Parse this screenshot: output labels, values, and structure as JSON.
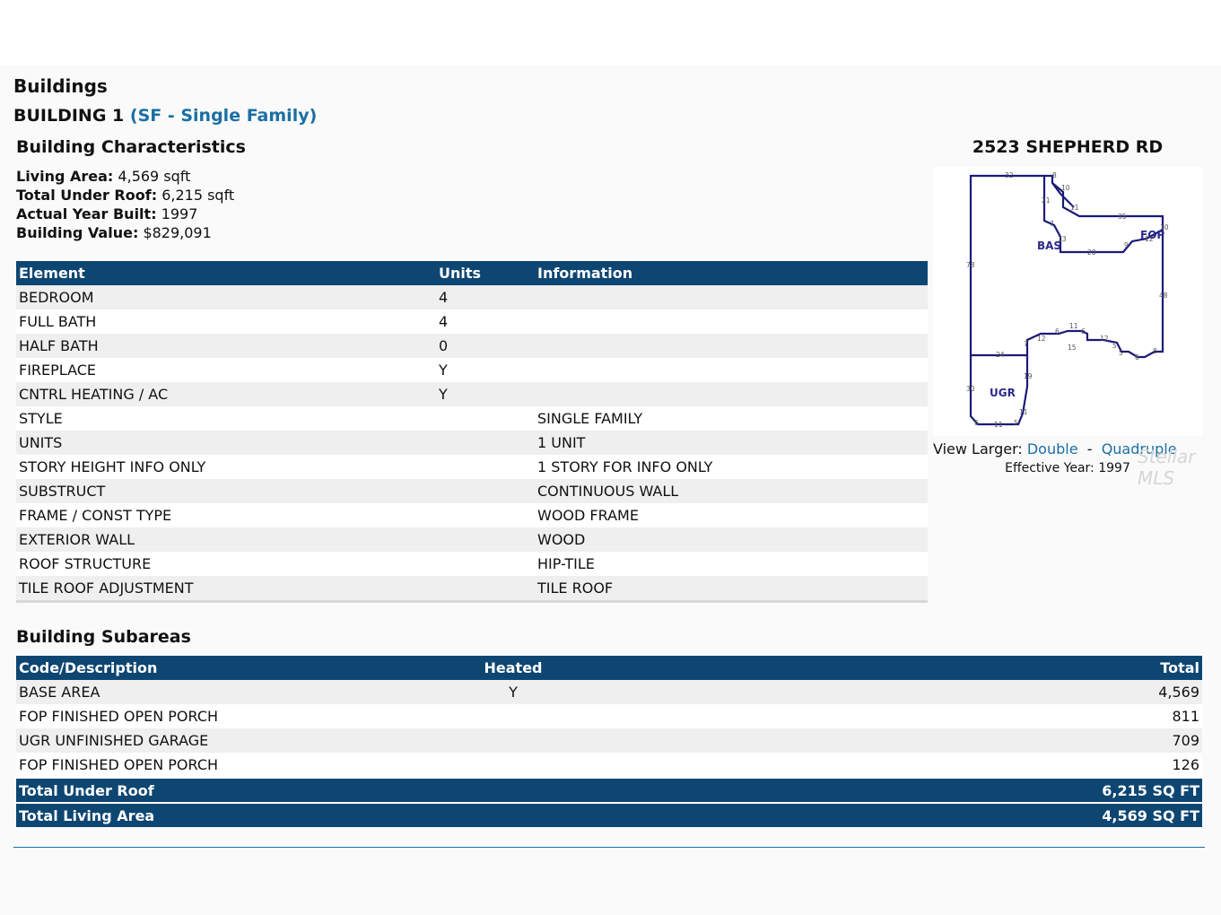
{
  "headings": {
    "buildings": "Buildings",
    "building_label": "BUILDING 1",
    "building_type": "(SF - Single Family)",
    "characteristics": "Building Characteristics",
    "subareas": "Building Subareas"
  },
  "summary": {
    "living_area_label": "Living Area:",
    "living_area_value": "4,569 sqft",
    "under_roof_label": "Total Under Roof:",
    "under_roof_value": "6,215 sqft",
    "year_built_label": "Actual Year Built:",
    "year_built_value": "1997",
    "value_label": "Building Value:",
    "value_value": "$829,091"
  },
  "elements_table": {
    "headers": [
      "Element",
      "Units",
      "Information"
    ],
    "rows": [
      [
        "BEDROOM",
        "4",
        ""
      ],
      [
        "FULL BATH",
        "4",
        ""
      ],
      [
        "HALF BATH",
        "0",
        ""
      ],
      [
        "FIREPLACE",
        "Y",
        ""
      ],
      [
        "CNTRL HEATING / AC",
        "Y",
        ""
      ],
      [
        "STYLE",
        "",
        "SINGLE FAMILY"
      ],
      [
        "UNITS",
        "",
        "1 UNIT"
      ],
      [
        "STORY HEIGHT INFO ONLY",
        "",
        "1 STORY FOR INFO ONLY"
      ],
      [
        "SUBSTRUCT",
        "",
        "CONTINUOUS WALL"
      ],
      [
        "FRAME / CONST TYPE",
        "",
        "WOOD FRAME"
      ],
      [
        "EXTERIOR WALL",
        "",
        "WOOD"
      ],
      [
        "ROOF STRUCTURE",
        "",
        "HIP-TILE"
      ],
      [
        "TILE ROOF ADJUSTMENT",
        "",
        "TILE ROOF"
      ]
    ]
  },
  "sketch": {
    "title": "2523 SHEPHERD RD",
    "labels": {
      "bas": "BAS",
      "fop": "FOP",
      "ugr": "UGR"
    },
    "dims": [
      "32",
      "8",
      "10",
      "21",
      "11",
      "35",
      "10",
      "12",
      "7",
      "13",
      "20",
      "9",
      "78",
      "48",
      "12",
      "6",
      "11",
      "6",
      "12",
      "7",
      "15",
      "5",
      "5",
      "6",
      "8",
      "24",
      "19",
      "30",
      "11",
      "6",
      "11",
      "5"
    ],
    "view_larger_label": "View Larger:",
    "link_double": "Double",
    "separator": "-",
    "link_quadruple": "Quadruple",
    "effective_year_label": "Effective Year:",
    "effective_year_value": "1997",
    "watermark": "Stellar MLS"
  },
  "subareas_table": {
    "headers": [
      "Code/Description",
      "Heated",
      "Total"
    ],
    "rows": [
      [
        "BASE AREA",
        "Y",
        "4,569"
      ],
      [
        "FOP FINISHED OPEN PORCH",
        "",
        "811"
      ],
      [
        "UGR UNFINISHED GARAGE",
        "",
        "709"
      ],
      [
        "FOP FINISHED OPEN PORCH",
        "",
        "126"
      ]
    ],
    "totals": [
      [
        "Total Under Roof",
        "6,215 SQ FT"
      ],
      [
        "Total Living Area",
        "4,569 SQ FT"
      ]
    ]
  },
  "colors": {
    "header_bg": "#0e4672",
    "link": "#1a6fa3",
    "sketch_line": "#1a1a7a"
  }
}
